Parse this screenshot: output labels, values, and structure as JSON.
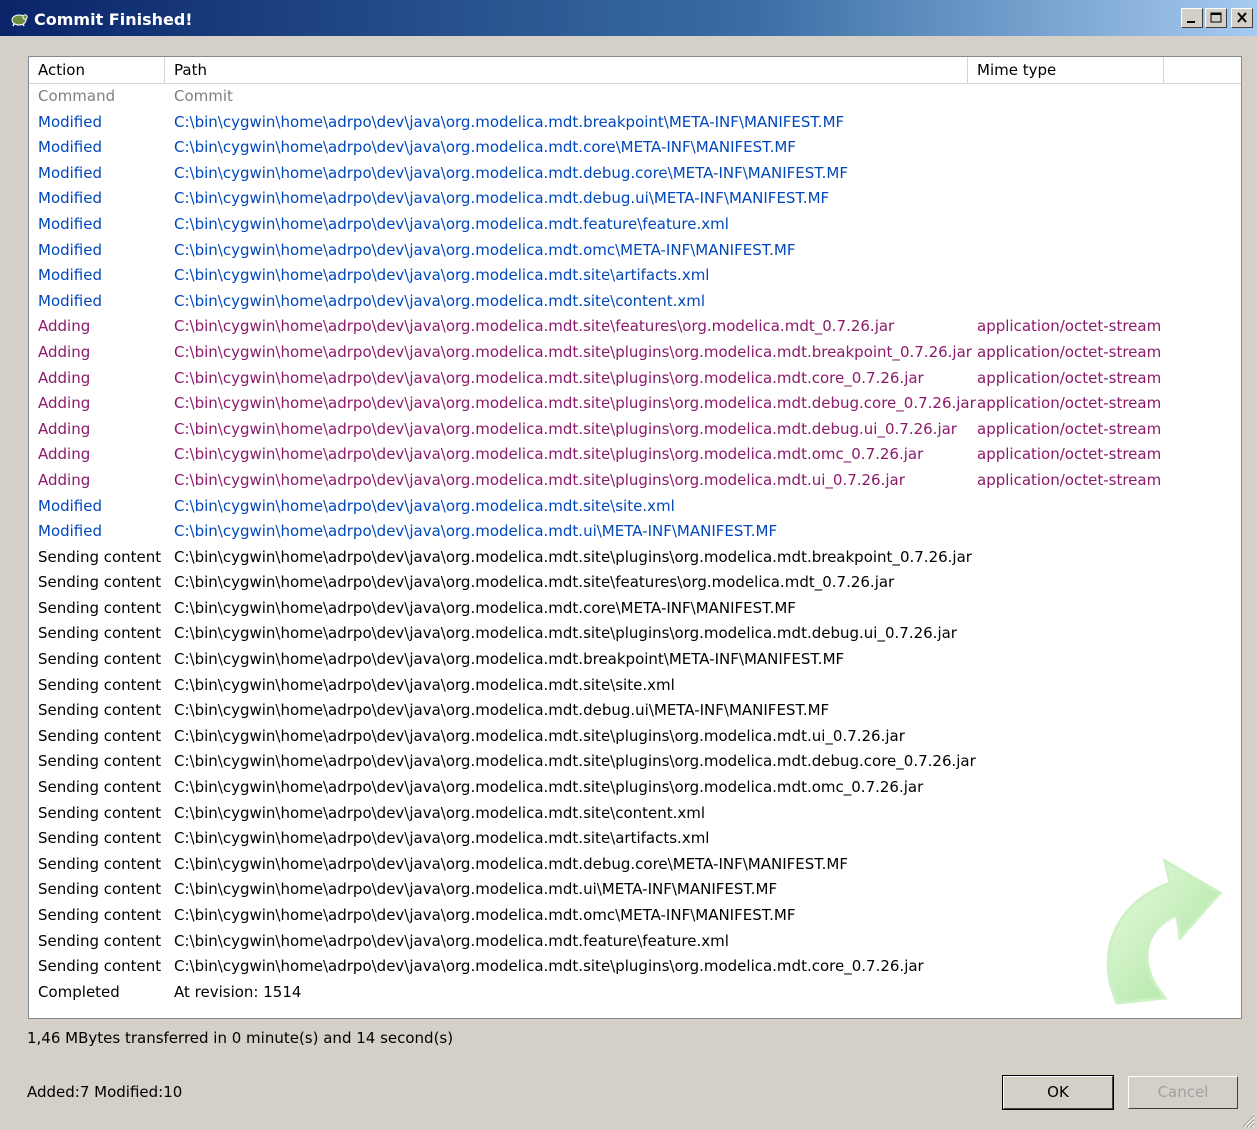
{
  "window": {
    "title": "Commit Finished!"
  },
  "columns": {
    "action": "Action",
    "path": "Path",
    "mime": "Mime type"
  },
  "rows": [
    {
      "action": "Command",
      "path": "Commit",
      "mime": "",
      "kind": "command"
    },
    {
      "action": "Modified",
      "path": "C:\\bin\\cygwin\\home\\adrpo\\dev\\java\\org.modelica.mdt.breakpoint\\META-INF\\MANIFEST.MF",
      "mime": "",
      "kind": "modified"
    },
    {
      "action": "Modified",
      "path": "C:\\bin\\cygwin\\home\\adrpo\\dev\\java\\org.modelica.mdt.core\\META-INF\\MANIFEST.MF",
      "mime": "",
      "kind": "modified"
    },
    {
      "action": "Modified",
      "path": "C:\\bin\\cygwin\\home\\adrpo\\dev\\java\\org.modelica.mdt.debug.core\\META-INF\\MANIFEST.MF",
      "mime": "",
      "kind": "modified"
    },
    {
      "action": "Modified",
      "path": "C:\\bin\\cygwin\\home\\adrpo\\dev\\java\\org.modelica.mdt.debug.ui\\META-INF\\MANIFEST.MF",
      "mime": "",
      "kind": "modified"
    },
    {
      "action": "Modified",
      "path": "C:\\bin\\cygwin\\home\\adrpo\\dev\\java\\org.modelica.mdt.feature\\feature.xml",
      "mime": "",
      "kind": "modified"
    },
    {
      "action": "Modified",
      "path": "C:\\bin\\cygwin\\home\\adrpo\\dev\\java\\org.modelica.mdt.omc\\META-INF\\MANIFEST.MF",
      "mime": "",
      "kind": "modified"
    },
    {
      "action": "Modified",
      "path": "C:\\bin\\cygwin\\home\\adrpo\\dev\\java\\org.modelica.mdt.site\\artifacts.xml",
      "mime": "",
      "kind": "modified"
    },
    {
      "action": "Modified",
      "path": "C:\\bin\\cygwin\\home\\adrpo\\dev\\java\\org.modelica.mdt.site\\content.xml",
      "mime": "",
      "kind": "modified"
    },
    {
      "action": "Adding",
      "path": "C:\\bin\\cygwin\\home\\adrpo\\dev\\java\\org.modelica.mdt.site\\features\\org.modelica.mdt_0.7.26.jar",
      "mime": "application/octet-stream",
      "kind": "adding"
    },
    {
      "action": "Adding",
      "path": "C:\\bin\\cygwin\\home\\adrpo\\dev\\java\\org.modelica.mdt.site\\plugins\\org.modelica.mdt.breakpoint_0.7.26.jar",
      "mime": "application/octet-stream",
      "kind": "adding"
    },
    {
      "action": "Adding",
      "path": "C:\\bin\\cygwin\\home\\adrpo\\dev\\java\\org.modelica.mdt.site\\plugins\\org.modelica.mdt.core_0.7.26.jar",
      "mime": "application/octet-stream",
      "kind": "adding"
    },
    {
      "action": "Adding",
      "path": "C:\\bin\\cygwin\\home\\adrpo\\dev\\java\\org.modelica.mdt.site\\plugins\\org.modelica.mdt.debug.core_0.7.26.jar",
      "mime": "application/octet-stream",
      "kind": "adding"
    },
    {
      "action": "Adding",
      "path": "C:\\bin\\cygwin\\home\\adrpo\\dev\\java\\org.modelica.mdt.site\\plugins\\org.modelica.mdt.debug.ui_0.7.26.jar",
      "mime": "application/octet-stream",
      "kind": "adding"
    },
    {
      "action": "Adding",
      "path": "C:\\bin\\cygwin\\home\\adrpo\\dev\\java\\org.modelica.mdt.site\\plugins\\org.modelica.mdt.omc_0.7.26.jar",
      "mime": "application/octet-stream",
      "kind": "adding"
    },
    {
      "action": "Adding",
      "path": "C:\\bin\\cygwin\\home\\adrpo\\dev\\java\\org.modelica.mdt.site\\plugins\\org.modelica.mdt.ui_0.7.26.jar",
      "mime": "application/octet-stream",
      "kind": "adding"
    },
    {
      "action": "Modified",
      "path": "C:\\bin\\cygwin\\home\\adrpo\\dev\\java\\org.modelica.mdt.site\\site.xml",
      "mime": "",
      "kind": "modified"
    },
    {
      "action": "Modified",
      "path": "C:\\bin\\cygwin\\home\\adrpo\\dev\\java\\org.modelica.mdt.ui\\META-INF\\MANIFEST.MF",
      "mime": "",
      "kind": "modified"
    },
    {
      "action": "Sending content",
      "path": "C:\\bin\\cygwin\\home\\adrpo\\dev\\java\\org.modelica.mdt.site\\plugins\\org.modelica.mdt.breakpoint_0.7.26.jar",
      "mime": "",
      "kind": "default"
    },
    {
      "action": "Sending content",
      "path": "C:\\bin\\cygwin\\home\\adrpo\\dev\\java\\org.modelica.mdt.site\\features\\org.modelica.mdt_0.7.26.jar",
      "mime": "",
      "kind": "default"
    },
    {
      "action": "Sending content",
      "path": "C:\\bin\\cygwin\\home\\adrpo\\dev\\java\\org.modelica.mdt.core\\META-INF\\MANIFEST.MF",
      "mime": "",
      "kind": "default"
    },
    {
      "action": "Sending content",
      "path": "C:\\bin\\cygwin\\home\\adrpo\\dev\\java\\org.modelica.mdt.site\\plugins\\org.modelica.mdt.debug.ui_0.7.26.jar",
      "mime": "",
      "kind": "default"
    },
    {
      "action": "Sending content",
      "path": "C:\\bin\\cygwin\\home\\adrpo\\dev\\java\\org.modelica.mdt.breakpoint\\META-INF\\MANIFEST.MF",
      "mime": "",
      "kind": "default"
    },
    {
      "action": "Sending content",
      "path": "C:\\bin\\cygwin\\home\\adrpo\\dev\\java\\org.modelica.mdt.site\\site.xml",
      "mime": "",
      "kind": "default"
    },
    {
      "action": "Sending content",
      "path": "C:\\bin\\cygwin\\home\\adrpo\\dev\\java\\org.modelica.mdt.debug.ui\\META-INF\\MANIFEST.MF",
      "mime": "",
      "kind": "default"
    },
    {
      "action": "Sending content",
      "path": "C:\\bin\\cygwin\\home\\adrpo\\dev\\java\\org.modelica.mdt.site\\plugins\\org.modelica.mdt.ui_0.7.26.jar",
      "mime": "",
      "kind": "default"
    },
    {
      "action": "Sending content",
      "path": "C:\\bin\\cygwin\\home\\adrpo\\dev\\java\\org.modelica.mdt.site\\plugins\\org.modelica.mdt.debug.core_0.7.26.jar",
      "mime": "",
      "kind": "default"
    },
    {
      "action": "Sending content",
      "path": "C:\\bin\\cygwin\\home\\adrpo\\dev\\java\\org.modelica.mdt.site\\plugins\\org.modelica.mdt.omc_0.7.26.jar",
      "mime": "",
      "kind": "default"
    },
    {
      "action": "Sending content",
      "path": "C:\\bin\\cygwin\\home\\adrpo\\dev\\java\\org.modelica.mdt.site\\content.xml",
      "mime": "",
      "kind": "default"
    },
    {
      "action": "Sending content",
      "path": "C:\\bin\\cygwin\\home\\adrpo\\dev\\java\\org.modelica.mdt.site\\artifacts.xml",
      "mime": "",
      "kind": "default"
    },
    {
      "action": "Sending content",
      "path": "C:\\bin\\cygwin\\home\\adrpo\\dev\\java\\org.modelica.mdt.debug.core\\META-INF\\MANIFEST.MF",
      "mime": "",
      "kind": "default"
    },
    {
      "action": "Sending content",
      "path": "C:\\bin\\cygwin\\home\\adrpo\\dev\\java\\org.modelica.mdt.ui\\META-INF\\MANIFEST.MF",
      "mime": "",
      "kind": "default"
    },
    {
      "action": "Sending content",
      "path": "C:\\bin\\cygwin\\home\\adrpo\\dev\\java\\org.modelica.mdt.omc\\META-INF\\MANIFEST.MF",
      "mime": "",
      "kind": "default"
    },
    {
      "action": "Sending content",
      "path": "C:\\bin\\cygwin\\home\\adrpo\\dev\\java\\org.modelica.mdt.feature\\feature.xml",
      "mime": "",
      "kind": "default"
    },
    {
      "action": "Sending content",
      "path": "C:\\bin\\cygwin\\home\\adrpo\\dev\\java\\org.modelica.mdt.site\\plugins\\org.modelica.mdt.core_0.7.26.jar",
      "mime": "",
      "kind": "default"
    },
    {
      "action": "Completed",
      "path": "At revision: 1514",
      "mime": "",
      "kind": "default"
    }
  ],
  "status": {
    "transfer": "1,46 MBytes transferred in 0 minute(s) and 14 second(s)",
    "summary": "Added:7 Modified:10"
  },
  "buttons": {
    "ok": "OK",
    "cancel": "Cancel"
  },
  "icons": {
    "app": "tortoise-icon",
    "decoration": "green-arrow-icon"
  },
  "colors": {
    "command": "#808080",
    "modified": "#0047bb",
    "adding": "#8b1a6b",
    "default": "#000000"
  }
}
